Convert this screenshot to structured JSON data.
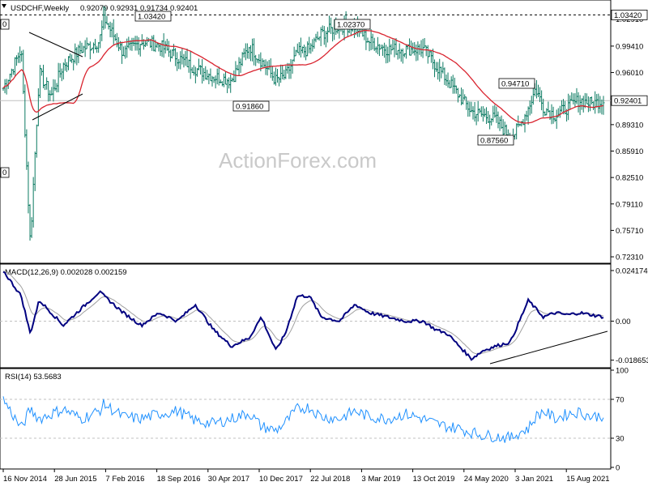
{
  "header": {
    "symbol_timeframe": "USDCHF,Weekly",
    "ohlc": "0.92079 0.92931 0.91734 0.92401"
  },
  "watermark": "ActionForex.com",
  "price_panel": {
    "y_ticks": [
      "1.02910",
      "0.99410",
      "0.96010",
      "0.92610",
      "0.89310",
      "0.85910",
      "0.82510",
      "0.79110",
      "0.75710",
      "0.72310"
    ],
    "y_tick_values": [
      1.0291,
      0.9941,
      0.9601,
      0.9261,
      0.8931,
      0.8591,
      0.8251,
      0.7911,
      0.7571,
      0.7231
    ],
    "ylim": [
      0.7169,
      1.0513
    ],
    "current_price_label": "0.92401",
    "current_price": 0.92401,
    "top_line_label": "1.03420",
    "top_line_price": 1.0342,
    "left_edge_label_1": "0",
    "left_edge_label_2": "0",
    "callouts": [
      {
        "label": "1.03420",
        "t": 0.168
      },
      {
        "label": "1.02370",
        "t": 0.586
      },
      {
        "label": "0.91860",
        "t": 0.454
      },
      {
        "label": "0.94710",
        "t": 0.887
      },
      {
        "label": "0.87560",
        "t": 0.845
      }
    ]
  },
  "macd_panel": {
    "title": "MACD(12,26,9) 0.002028 0.002159",
    "y_ticks": [
      "0.024174",
      "0.00",
      "-0.018653"
    ],
    "y_tick_values": [
      0.024174,
      0.0,
      -0.018653
    ],
    "ylim": [
      -0.0215,
      0.0265
    ]
  },
  "rsi_panel": {
    "title": "RSI(14) 53.5683",
    "y_ticks": [
      "100",
      "70",
      "30",
      "0"
    ],
    "y_tick_values": [
      100,
      70,
      30,
      0
    ],
    "ylim": [
      0,
      100
    ]
  },
  "x_axis": {
    "labels": [
      "16 Nov 2014",
      "28 Jun 2015",
      "7 Feb 2016",
      "18 Sep 2016",
      "30 Apr 2017",
      "10 Dec 2017",
      "22 Jul 2018",
      "3 Mar 2019",
      "13 Oct 2019",
      "24 May 2020",
      "3 Jan 2021",
      "15 Aug 2021"
    ]
  },
  "colors": {
    "bars": "#0b7a62",
    "ma": "#d9232e",
    "macd": "#000080",
    "signal": "#a0a0a0",
    "rsi": "#1e90ff",
    "grid": "#c0c0c0",
    "axis": "#000000"
  },
  "chart_data": {
    "type": "ohlc",
    "series": [
      {
        "name": "USDCHF",
        "x": [
          0.0,
          0.03,
          0.045,
          0.06,
          0.08,
          0.1,
          0.13,
          0.16,
          0.168,
          0.2,
          0.23,
          0.26,
          0.29,
          0.32,
          0.35,
          0.38,
          0.41,
          0.43,
          0.454,
          0.47,
          0.49,
          0.51,
          0.53,
          0.56,
          0.586,
          0.61,
          0.64,
          0.67,
          0.7,
          0.72,
          0.74,
          0.76,
          0.78,
          0.8,
          0.82,
          0.845,
          0.86,
          0.875,
          0.887,
          0.9,
          0.92,
          0.94,
          0.96,
          0.98,
          1.0
        ],
        "close": [
          0.94,
          0.99,
          0.74,
          0.96,
          0.93,
          0.97,
          0.99,
          1.0,
          1.03,
          0.985,
          1.0,
          0.995,
          0.98,
          0.965,
          0.955,
          0.95,
          0.995,
          0.975,
          0.95,
          0.955,
          0.985,
          0.99,
          1.01,
          1.02,
          1.02,
          1.0,
          0.99,
          0.99,
          0.99,
          0.97,
          0.95,
          0.93,
          0.91,
          0.905,
          0.9,
          0.876,
          0.89,
          0.915,
          0.94,
          0.915,
          0.905,
          0.915,
          0.925,
          0.92,
          0.924
        ]
      }
    ],
    "macd": [
      0.024,
      0.012,
      -0.006,
      0.01,
      0.004,
      -0.002,
      0.006,
      0.014,
      0.012,
      0.004,
      -0.002,
      0.004,
      0.0,
      0.008,
      -0.004,
      -0.012,
      -0.008,
      0.002,
      -0.014,
      -0.006,
      0.012,
      0.012,
      0.002,
      0.0,
      0.008,
      0.004,
      0.002,
      0.0,
      0.0,
      -0.004,
      -0.006,
      -0.012,
      -0.018,
      -0.014,
      -0.012,
      -0.01,
      0.0,
      0.01,
      0.006,
      0.002,
      0.004,
      0.003,
      0.004,
      0.003,
      0.002
    ],
    "rsi": [
      70,
      40,
      60,
      50,
      55,
      60,
      50,
      58,
      65,
      52,
      50,
      55,
      58,
      48,
      45,
      50,
      56,
      42,
      38,
      46,
      60,
      62,
      52,
      50,
      58,
      52,
      50,
      55,
      50,
      45,
      42,
      40,
      36,
      33,
      32,
      30,
      36,
      40,
      52,
      58,
      50,
      55,
      57,
      52,
      53.5683
    ]
  }
}
